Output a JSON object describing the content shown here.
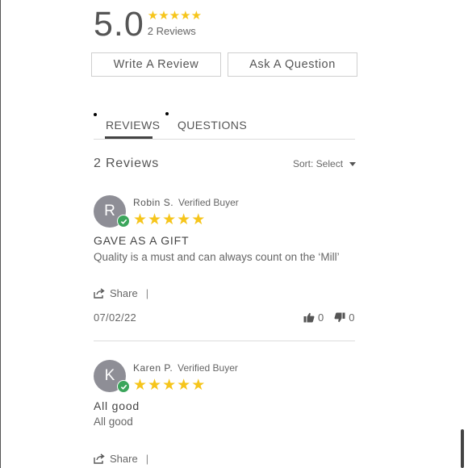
{
  "summary": {
    "average": "5.0",
    "count_text": "2 Reviews",
    "star_color": "#f6c51b"
  },
  "buttons": {
    "write_review": "Write A Review",
    "ask_question": "Ask A Question"
  },
  "tabs": {
    "reviews": "REVIEWS",
    "questions": "QUESTIONS",
    "active": "REVIEWS"
  },
  "list_header": {
    "count": "2 Reviews",
    "sort_label": "Sort: Select"
  },
  "reviews": [
    {
      "initial": "R",
      "name": "Robin S.",
      "badge": "Verified Buyer",
      "rating": 5,
      "title": "GAVE AS A GIFT",
      "body": "Quality is a must and can always count on the ‘Mill’",
      "share": "Share",
      "share_sep": "|",
      "date": "07/02/22",
      "up": "0",
      "down": "0"
    },
    {
      "initial": "K",
      "name": "Karen P.",
      "badge": "Verified Buyer",
      "rating": 5,
      "title": "All good",
      "body": "All good",
      "share": "Share",
      "share_sep": "|"
    }
  ]
}
